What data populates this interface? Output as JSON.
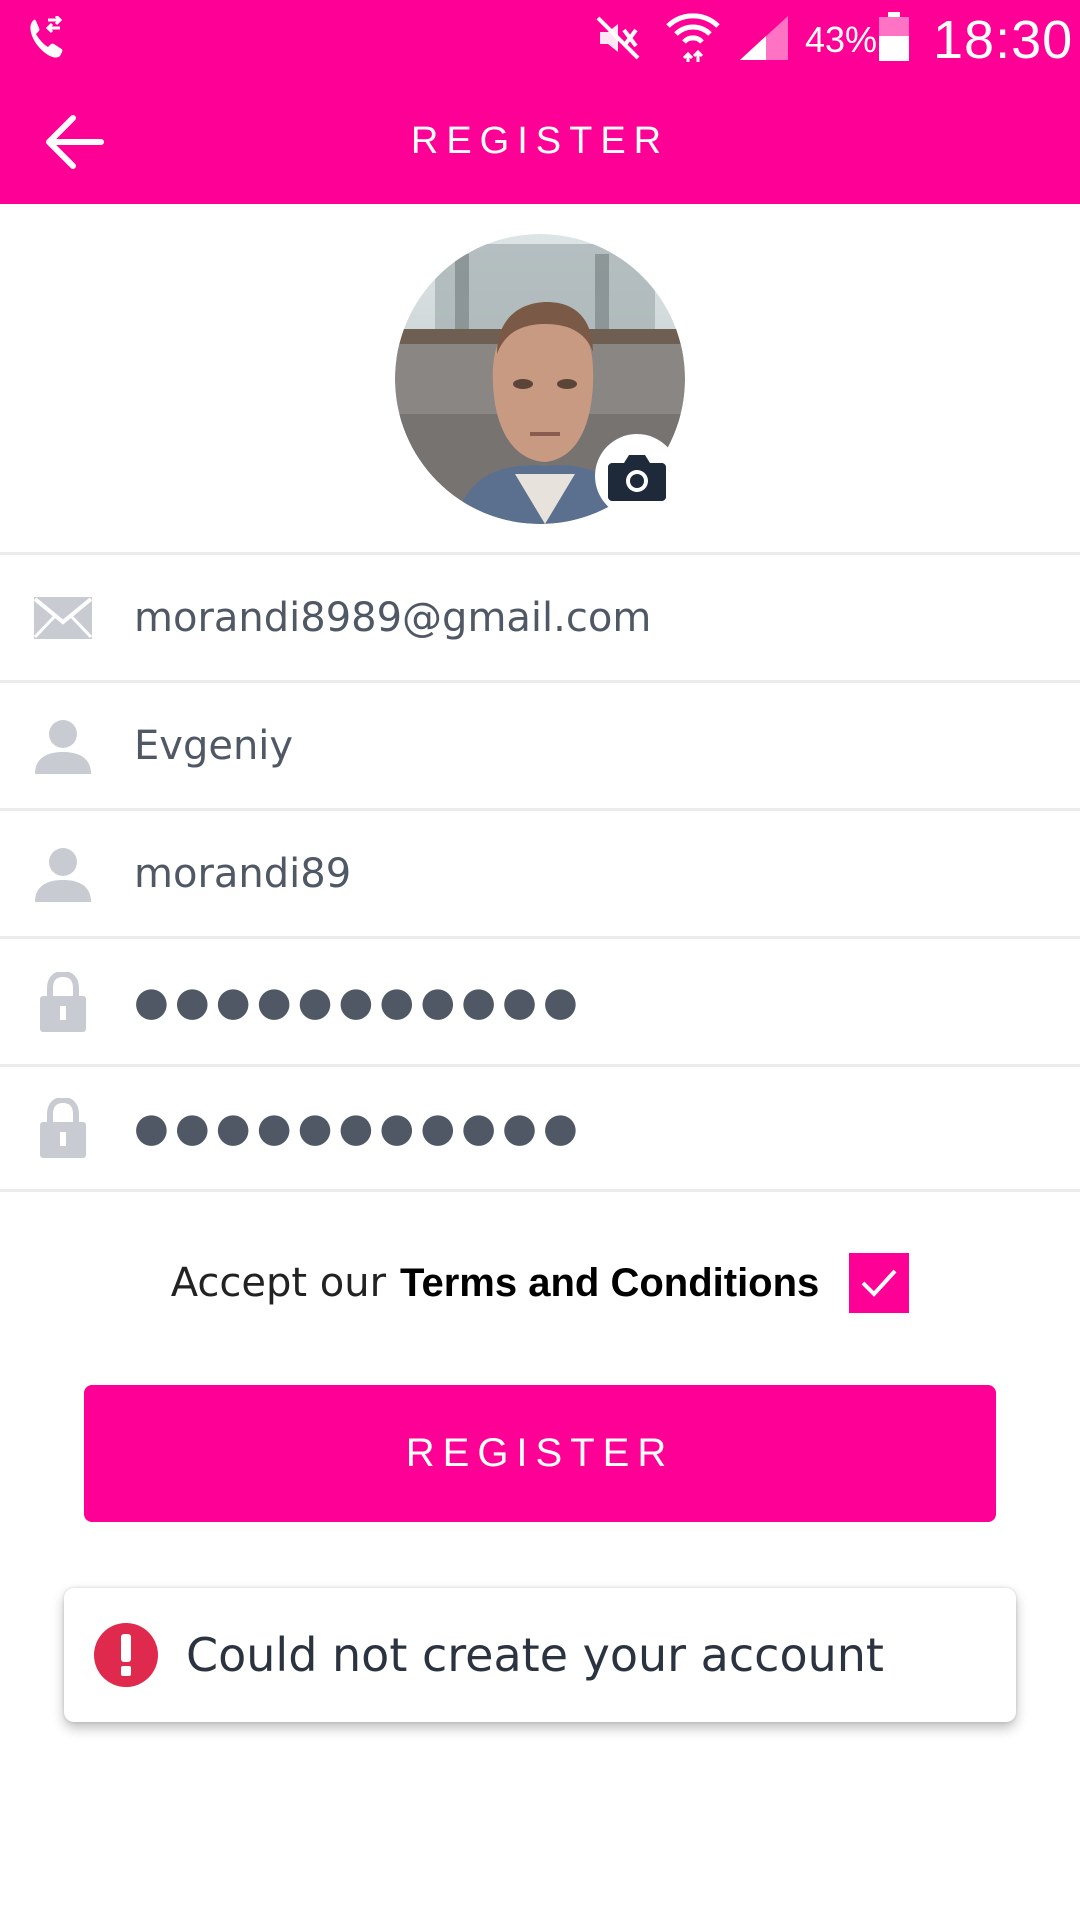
{
  "status_bar": {
    "battery_percent": "43%",
    "time": "18:30",
    "icons": [
      "call-icon",
      "mute-icon",
      "wifi-icon",
      "signal-icon",
      "battery-icon"
    ]
  },
  "app_bar": {
    "title": "REGISTER",
    "back_icon": "arrow-left-icon"
  },
  "avatar": {
    "camera_icon": "camera-icon"
  },
  "form": {
    "email": {
      "value": "morandi8989@gmail.com",
      "icon": "mail-icon"
    },
    "first_name": {
      "value": "Evgeniy",
      "icon": "person-icon"
    },
    "username": {
      "value": "morandi89",
      "icon": "person-icon"
    },
    "password": {
      "value": "●●●●●●●●●●●",
      "icon": "lock-icon"
    },
    "confirm_password": {
      "value": "●●●●●●●●●●●",
      "icon": "lock-icon"
    }
  },
  "terms": {
    "prefix": "Accept our",
    "link": "Terms and Conditions",
    "checked": true
  },
  "register_button": {
    "label": "REGISTER"
  },
  "toast": {
    "message": "Could not create your account",
    "icon": "error-icon"
  },
  "colors": {
    "accent": "#ff0096",
    "error": "#e02a4d",
    "icon_gray": "#c8ccd2"
  }
}
